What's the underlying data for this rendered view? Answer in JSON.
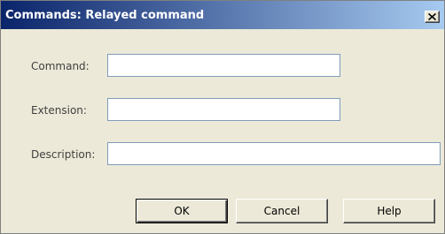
{
  "window": {
    "title": "Commands: Relayed command",
    "close_label": "X"
  },
  "form": {
    "command": {
      "label": "Command:",
      "value": ""
    },
    "extension": {
      "label": "Extension:",
      "value": ""
    },
    "description": {
      "label": "Description:",
      "value": ""
    }
  },
  "buttons": {
    "ok": "OK",
    "cancel": "Cancel",
    "help": "Help"
  }
}
